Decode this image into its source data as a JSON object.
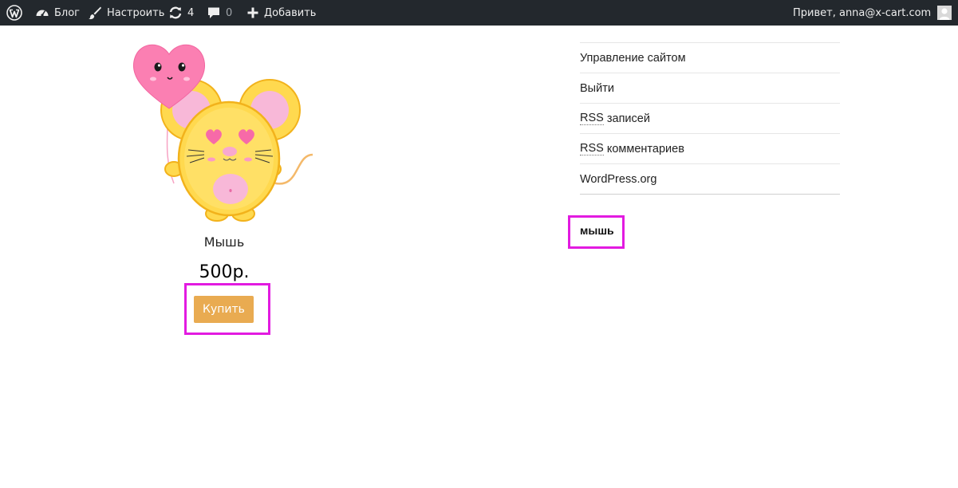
{
  "adminbar": {
    "blog_label": "Блог",
    "customize_label": "Настроить",
    "updates_count": "4",
    "comments_count": "0",
    "add_label": "Добавить",
    "greeting": "Привет, anna@x-cart.com"
  },
  "product": {
    "name": "Мышь",
    "price": "500р.",
    "buy_label": "Купить"
  },
  "meta": {
    "items": [
      {
        "label": "Управление сайтом"
      },
      {
        "label": "Выйти"
      },
      {
        "abbr": "RSS",
        "rest": " записей"
      },
      {
        "abbr": "RSS",
        "rest": " комментариев"
      },
      {
        "label": "WordPress.org"
      }
    ]
  },
  "tag_word": "мышь",
  "colors": {
    "adminbar_bg": "#23282d",
    "buy_button": "#e9ab51",
    "highlight": "#e21be0"
  },
  "icons": [
    "wordpress-icon",
    "dashboard-icon",
    "brush-icon",
    "updates-icon",
    "comment-icon",
    "plus-icon",
    "avatar"
  ]
}
